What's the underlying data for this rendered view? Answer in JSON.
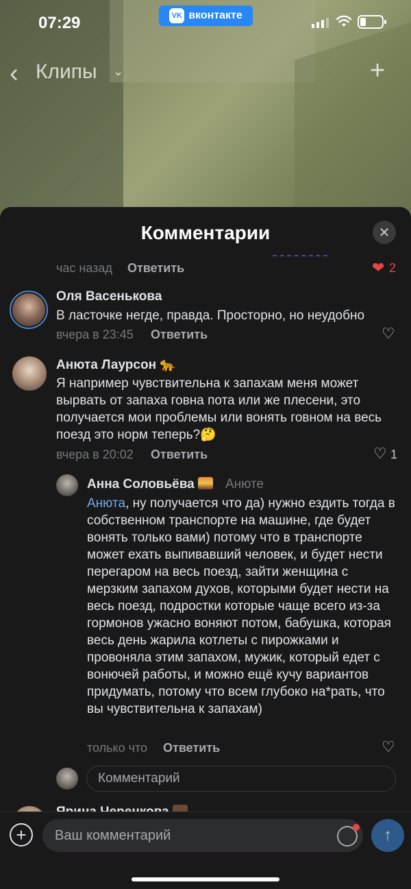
{
  "status": {
    "time": "07:29",
    "app_pill": "вконтакте",
    "vk_logo": "VK"
  },
  "nav": {
    "back_icon": "‹",
    "title": "Клипы",
    "caret": "⌄",
    "plus": "+"
  },
  "sheet": {
    "title": "Комментарии",
    "close_icon": "✕"
  },
  "prev_comment": {
    "time": "час назад",
    "reply": "Ответить",
    "likes": "2"
  },
  "comments": [
    {
      "author": "Оля Васенькова",
      "text": "В ласточке негде, правда. Просторно, но неудобно",
      "time": "вчера в 23:45",
      "reply": "Ответить"
    },
    {
      "author": "Анюта Лаурсон",
      "author_emoji": "🐆",
      "text": "Я например чувствительна к запахам меня может вырвать от запаха говна пота или же плесени, это получается мои проблемы или вонять говном на весь поезд это норм теперь?",
      "text_emoji": "🤔",
      "time": "вчера в 20:02",
      "reply": "Ответить",
      "likes": "1"
    }
  ],
  "nested_reply": {
    "author": "Анна Соловьёва",
    "reply_to": "Анюте",
    "mention": "Анюта",
    "text": ", ну получается что да) нужно ездить тогда в собственном транспорте на машине, где будет вонять только вами) потому что в транспорте может ехать выпивавший человек, и будет нести перегаром на весь поезд, зайти женщина с мерзким запахом духов, которыми будет нести на весь поезд, подростки которые чаще всего из-за гормонов ужасно воняют потом, бабушка, которая весь день жарила котлеты с пирожками и провоняла этим запахом, мужик, который едет с вонючей работы, и можно ещё кучу вариантов придумать, потому что всем глубоко на*рать, что вы чувствительна к запахам)",
    "time": "только что",
    "reply": "Ответить"
  },
  "inline_input": {
    "placeholder": "Комментарий"
  },
  "next_author": "Ярина Черенкова",
  "compose": {
    "placeholder": "Ваш комментарий",
    "add_icon": "+",
    "send_icon": "↑"
  },
  "colors": {
    "sheet_bg": "#19191a",
    "accent": "#2787f5",
    "mention": "#71aaeb",
    "like_red": "#e64646"
  }
}
